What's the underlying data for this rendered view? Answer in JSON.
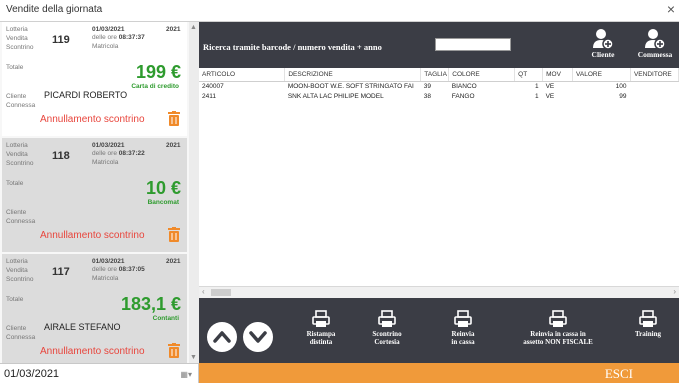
{
  "window": {
    "title": "Vendite della giornata",
    "close": "×"
  },
  "labels": {
    "lotteria": "Lotteria",
    "vendita": "Vendita",
    "scontrino": "Scontrino",
    "delle_ore": "delle ore",
    "matricola": "Matricola",
    "totale": "Totale",
    "cliente": "Cliente",
    "connessa": "Connessa"
  },
  "sales": [
    {
      "number": "119",
      "date": "01/03/2021",
      "year": "2021",
      "time": "08:37:37",
      "amount": "199 €",
      "payment": "Carta di credito",
      "client": "PICARDI ROBERTO",
      "annul": "Annullamento scontrino"
    },
    {
      "number": "118",
      "date": "01/03/2021",
      "year": "2021",
      "time": "08:37:22",
      "amount": "10 €",
      "payment": "Bancomat",
      "client": "",
      "annul": "Annullamento scontrino"
    },
    {
      "number": "117",
      "date": "01/03/2021",
      "year": "2021",
      "time": "08:37:05",
      "amount": "183,1 €",
      "payment": "Contanti",
      "client": "AIRALE  STEFANO",
      "annul": "Annullamento scontrino"
    }
  ],
  "current_date": "01/03/2021",
  "search": {
    "label": "Ricerca tramite barcode / numero vendita + anno",
    "value": ""
  },
  "top_buttons": {
    "cliente": "Cliente",
    "commessa": "Commessa"
  },
  "table": {
    "headers": [
      "ARTICOLO",
      "DESCRIZIONE",
      "TAGLIA",
      "COLORE",
      "QT",
      "MOV",
      "VALORE",
      "VENDITORE"
    ],
    "rows": [
      [
        "240007",
        "MOON-BOOT W.E. SOFT STRINGATO FAI",
        "39",
        "BIANCO",
        "1",
        "VE",
        "100",
        ""
      ],
      [
        "2411",
        "SNK ALTA LAC PHILIPE MODEL",
        "38",
        "FANGO",
        "1",
        "VE",
        "99",
        ""
      ]
    ]
  },
  "bottom_buttons": [
    {
      "line1": "Ristampa",
      "line2": "distinta"
    },
    {
      "line1": "Scontrino",
      "line2": "Cortesia"
    },
    {
      "line1": "Reinvia",
      "line2": "in cassa"
    },
    {
      "line1": "Reinvia in cassa in",
      "line2": "assetto NON FISCALE"
    },
    {
      "line1": "Training",
      "line2": ""
    }
  ],
  "exit_label": "ESCI",
  "colors": {
    "dark_bar": "#3b3d45",
    "accent_orange": "#f09a3a",
    "amount_green": "#2e9b2e",
    "annul_red": "#e8453c"
  }
}
